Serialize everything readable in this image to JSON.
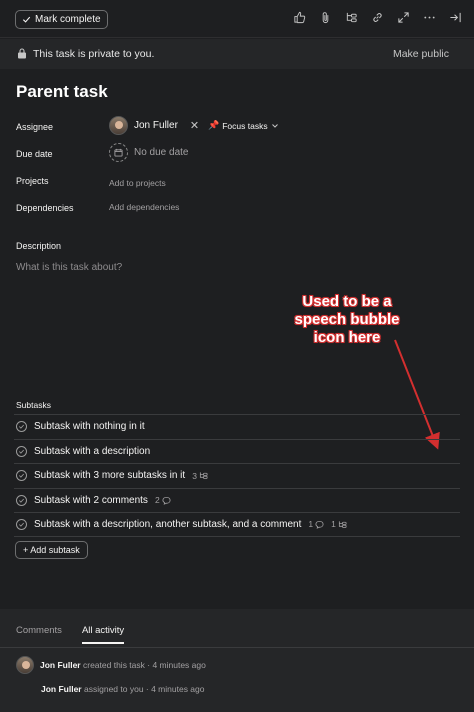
{
  "toolbar": {
    "mark_complete_label": "Mark complete",
    "icons": [
      "thumbs-up-icon",
      "attachment-icon",
      "subtask-icon",
      "link-icon",
      "expand-icon",
      "more-icon",
      "close-panel-icon"
    ]
  },
  "privacy_bar": {
    "text": "This task is private to you.",
    "make_public_label": "Make public"
  },
  "task": {
    "title": "Parent task"
  },
  "fields": {
    "assignee": {
      "label": "Assignee",
      "name": "Jon Fuller",
      "project_tag": "Focus tasks"
    },
    "due_date": {
      "label": "Due date",
      "value": "No due date"
    },
    "projects": {
      "label": "Projects",
      "action": "Add to projects"
    },
    "dependencies": {
      "label": "Dependencies",
      "action": "Add dependencies"
    }
  },
  "description": {
    "label": "Description",
    "placeholder": "What is this task about?"
  },
  "annotation": {
    "text": "Used to be a speech bubble icon here",
    "color": "#d32f2f"
  },
  "subtasks": {
    "label": "Subtasks",
    "items": [
      {
        "name": "Subtask with nothing in it",
        "comments": "",
        "subtasks": ""
      },
      {
        "name": "Subtask with a description",
        "comments": "",
        "subtasks": ""
      },
      {
        "name": "Subtask with 3 more subtasks in it",
        "comments": "",
        "subtasks": "3"
      },
      {
        "name": "Subtask with 2 comments",
        "comments": "2",
        "subtasks": ""
      },
      {
        "name": "Subtask with a description, another subtask, and a comment",
        "comments": "1",
        "subtasks": "1"
      }
    ],
    "add_label": "+ Add subtask"
  },
  "activity": {
    "tabs": [
      "Comments",
      "All activity"
    ],
    "active_tab": "All activity",
    "entries": [
      {
        "actor": "Jon Fuller",
        "text": "created this task · 4 minutes ago"
      },
      {
        "actor": "Jon Fuller",
        "text": "assigned to you · 4 minutes ago"
      }
    ]
  }
}
